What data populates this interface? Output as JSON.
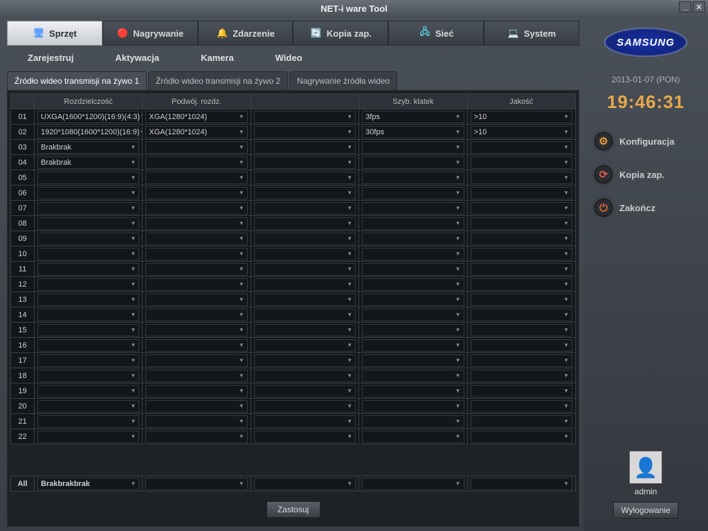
{
  "window": {
    "title": "NET-i ware Tool"
  },
  "main_tabs": [
    {
      "label": "Sprzęt",
      "icon": "🖥"
    },
    {
      "label": "Nagrywanie",
      "icon": "🔴"
    },
    {
      "label": "Zdarzenie",
      "icon": "🔔"
    },
    {
      "label": "Kopia zap.",
      "icon": "🔄"
    },
    {
      "label": "Sieć",
      "icon": "🖧"
    },
    {
      "label": "System",
      "icon": "💻"
    }
  ],
  "subnav": [
    "Zarejestruj",
    "Aktywacja",
    "Kamera",
    "Wideo"
  ],
  "inner_tabs": [
    "Źródło wideo transmisji na żywo 1",
    "Źródło wideo transmisji na żywo 2",
    "Nagrywanie źródła wideo"
  ],
  "columns": [
    "",
    "Rozdzielczość",
    "Podwój. rozdz.",
    "",
    "Szyb. klatek",
    "Jakość"
  ],
  "rows": [
    {
      "ch": "01",
      "res": "UXGA(1600*1200)(16:9)(4:3)",
      "dual": "XGA(1280*1024)",
      "col4": "",
      "fps": "3fps",
      "q": ">10"
    },
    {
      "ch": "02",
      "res": "1920*1080(1600*1200)(16:9)",
      "dual": "XGA(1280*1024)",
      "col4": "",
      "fps": "30fps",
      "q": ">10"
    },
    {
      "ch": "03",
      "res": "Brakbrak",
      "dual": "",
      "col4": "",
      "fps": "",
      "q": ""
    },
    {
      "ch": "04",
      "res": "Brakbrak",
      "dual": "",
      "col4": "",
      "fps": "",
      "q": ""
    },
    {
      "ch": "05",
      "res": "",
      "dual": "",
      "col4": "",
      "fps": "",
      "q": ""
    },
    {
      "ch": "06",
      "res": "",
      "dual": "",
      "col4": "",
      "fps": "",
      "q": ""
    },
    {
      "ch": "07",
      "res": "",
      "dual": "",
      "col4": "",
      "fps": "",
      "q": ""
    },
    {
      "ch": "08",
      "res": "",
      "dual": "",
      "col4": "",
      "fps": "",
      "q": ""
    },
    {
      "ch": "09",
      "res": "",
      "dual": "",
      "col4": "",
      "fps": "",
      "q": ""
    },
    {
      "ch": "10",
      "res": "",
      "dual": "",
      "col4": "",
      "fps": "",
      "q": ""
    },
    {
      "ch": "11",
      "res": "",
      "dual": "",
      "col4": "",
      "fps": "",
      "q": ""
    },
    {
      "ch": "12",
      "res": "",
      "dual": "",
      "col4": "",
      "fps": "",
      "q": ""
    },
    {
      "ch": "13",
      "res": "",
      "dual": "",
      "col4": "",
      "fps": "",
      "q": ""
    },
    {
      "ch": "14",
      "res": "",
      "dual": "",
      "col4": "",
      "fps": "",
      "q": ""
    },
    {
      "ch": "15",
      "res": "",
      "dual": "",
      "col4": "",
      "fps": "",
      "q": ""
    },
    {
      "ch": "16",
      "res": "",
      "dual": "",
      "col4": "",
      "fps": "",
      "q": ""
    },
    {
      "ch": "17",
      "res": "",
      "dual": "",
      "col4": "",
      "fps": "",
      "q": ""
    },
    {
      "ch": "18",
      "res": "",
      "dual": "",
      "col4": "",
      "fps": "",
      "q": ""
    },
    {
      "ch": "19",
      "res": "",
      "dual": "",
      "col4": "",
      "fps": "",
      "q": ""
    },
    {
      "ch": "20",
      "res": "",
      "dual": "",
      "col4": "",
      "fps": "",
      "q": ""
    },
    {
      "ch": "21",
      "res": "",
      "dual": "",
      "col4": "",
      "fps": "",
      "q": ""
    },
    {
      "ch": "22",
      "res": "",
      "dual": "",
      "col4": "",
      "fps": "",
      "q": ""
    }
  ],
  "summary_row": {
    "label": "All",
    "res": "Brakbrakbrak"
  },
  "apply_label": "Zastosuj",
  "sidebar": {
    "logo_text": "SAMSUNG",
    "date": "2013-01-07 (PON)",
    "time": "19:46:31",
    "items": [
      {
        "label": "Konfiguracja",
        "icon": "⚙"
      },
      {
        "label": "Kopia zap.",
        "icon": "⟳"
      },
      {
        "label": "Zakończ",
        "icon": "⏻"
      }
    ],
    "user": "admin",
    "logout_label": "Wylogowanie"
  }
}
